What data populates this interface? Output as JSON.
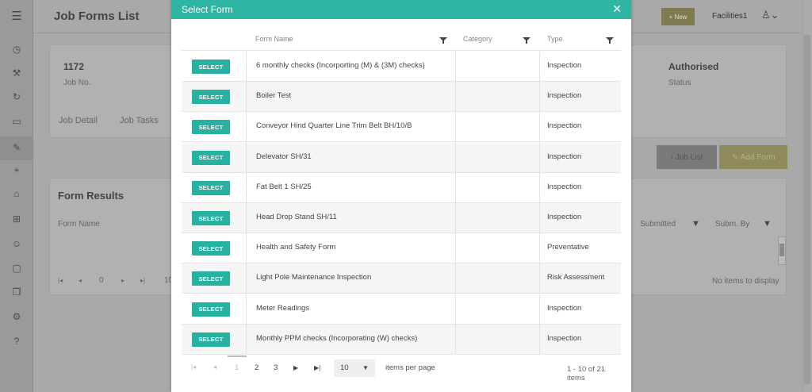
{
  "app": {
    "title": "Job Forms List",
    "new_label": "+ New",
    "user_label": "Facilities1"
  },
  "job": {
    "number": "1172",
    "number_label": "Job No.",
    "status": "Authorised",
    "status_label": "Status",
    "tabs": [
      "Job Detail",
      "Job Tasks"
    ],
    "job_list_label": "Job List",
    "add_form_label": "Add Form"
  },
  "form_results": {
    "title": "Form Results",
    "columns": [
      "Form Name",
      "Submitted",
      "Subm. By"
    ],
    "page": "0",
    "page_size": "10",
    "empty_text": "No items to display"
  },
  "modal": {
    "title": "Select Form",
    "close_icon": "close-icon",
    "columns": {
      "name": "Form Name",
      "category": "Category",
      "type": "Type"
    },
    "select_label": "SELECT",
    "rows": [
      {
        "name": "6 monthly checks (Incorporting (M) & (3M) checks)",
        "category": "",
        "type": "Inspection"
      },
      {
        "name": "Boiler Test",
        "category": "",
        "type": "Inspection"
      },
      {
        "name": "Conveyor Hind Quarter Line Trim Belt BH/10/B",
        "category": "",
        "type": "Inspection"
      },
      {
        "name": "Delevator SH/31",
        "category": "",
        "type": "Inspection"
      },
      {
        "name": "Fat Belt 1 SH/25",
        "category": "",
        "type": "Inspection"
      },
      {
        "name": "Head Drop Stand SH/11",
        "category": "",
        "type": "Inspection"
      },
      {
        "name": "Health and Safety Form",
        "category": "",
        "type": "Preventative"
      },
      {
        "name": "Light Pole Maintenance Inspection",
        "category": "",
        "type": "Risk Assessment"
      },
      {
        "name": "Meter Readings",
        "category": "",
        "type": "Inspection"
      },
      {
        "name": "Monthly PPM checks (Incorporating (W) checks)",
        "category": "",
        "type": "Inspection"
      }
    ],
    "pager": {
      "pages": [
        "1",
        "2",
        "3"
      ],
      "current_page": "1",
      "page_size": "10",
      "items_per_page_label": "items per page",
      "range_text": "1 - 10 of 21 items"
    }
  }
}
